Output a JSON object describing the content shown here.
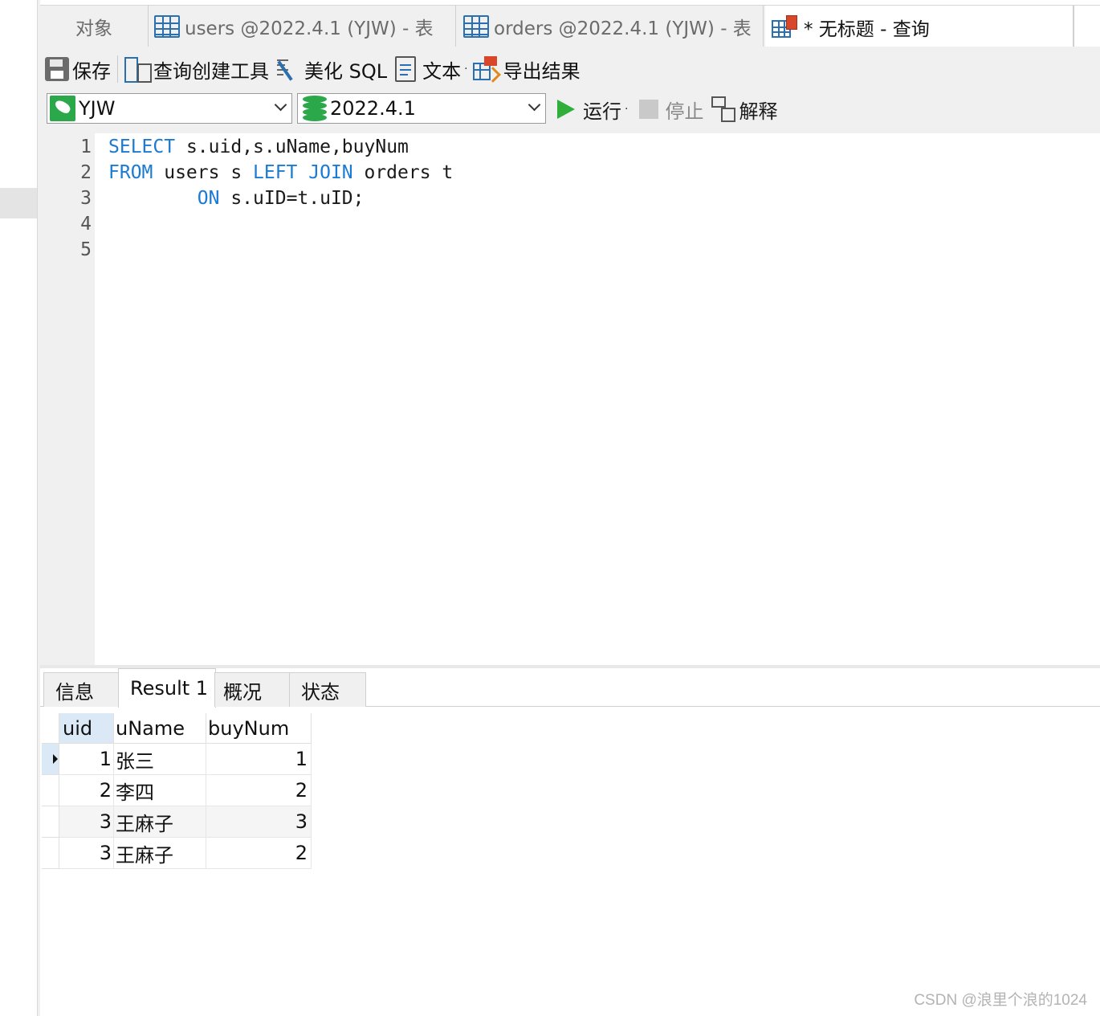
{
  "tabs": [
    {
      "label": "对象",
      "icon": "objects-tab"
    },
    {
      "label": "users @2022.4.1 (YJW) - 表",
      "icon": "table-icon"
    },
    {
      "label": "orders @2022.4.1 (YJW) - 表",
      "icon": "table-icon"
    },
    {
      "label": "* 无标题 - 查询",
      "icon": "query-icon",
      "active": true
    }
  ],
  "toolbar": {
    "save": "保存",
    "query_builder": "查询创建工具",
    "beautify": "美化 SQL",
    "text": "文本",
    "export": "导出结果"
  },
  "connection": {
    "selected": "YJW"
  },
  "database": {
    "selected": "2022.4.1"
  },
  "run_controls": {
    "run": "运行",
    "stop": "停止",
    "explain": "解释"
  },
  "editor": {
    "line_numbers": [
      "1",
      "2",
      "3",
      "4",
      "5"
    ],
    "lines": [
      [
        {
          "t": "SELECT",
          "kw": true
        },
        {
          "t": " s.uid,s.uName,buyNum",
          "kw": false
        }
      ],
      [
        {
          "t": "FROM",
          "kw": true
        },
        {
          "t": " users s ",
          "kw": false
        },
        {
          "t": "LEFT JOIN",
          "kw": true
        },
        {
          "t": " orders t",
          "kw": false
        }
      ],
      [
        {
          "t": "        ",
          "kw": false
        },
        {
          "t": "ON",
          "kw": true
        },
        {
          "t": " s.uID=t.uID;",
          "kw": false
        }
      ],
      [],
      []
    ]
  },
  "result_tabs": [
    "信息",
    "Result 1",
    "概况",
    "状态"
  ],
  "active_result_tab": "Result 1",
  "result": {
    "columns": [
      "uid",
      "uName",
      "buyNum"
    ],
    "rows": [
      [
        "1",
        "张三",
        "1"
      ],
      [
        "2",
        "李四",
        "2"
      ],
      [
        "3",
        "王麻子",
        "3"
      ],
      [
        "3",
        "王麻子",
        "2"
      ]
    ]
  },
  "colors": {
    "keyword": "#1a7ad4",
    "run_green": "#2fae3a",
    "accent_blue": "#2a6fb0"
  },
  "watermark": "CSDN @浪里个浪的1024"
}
